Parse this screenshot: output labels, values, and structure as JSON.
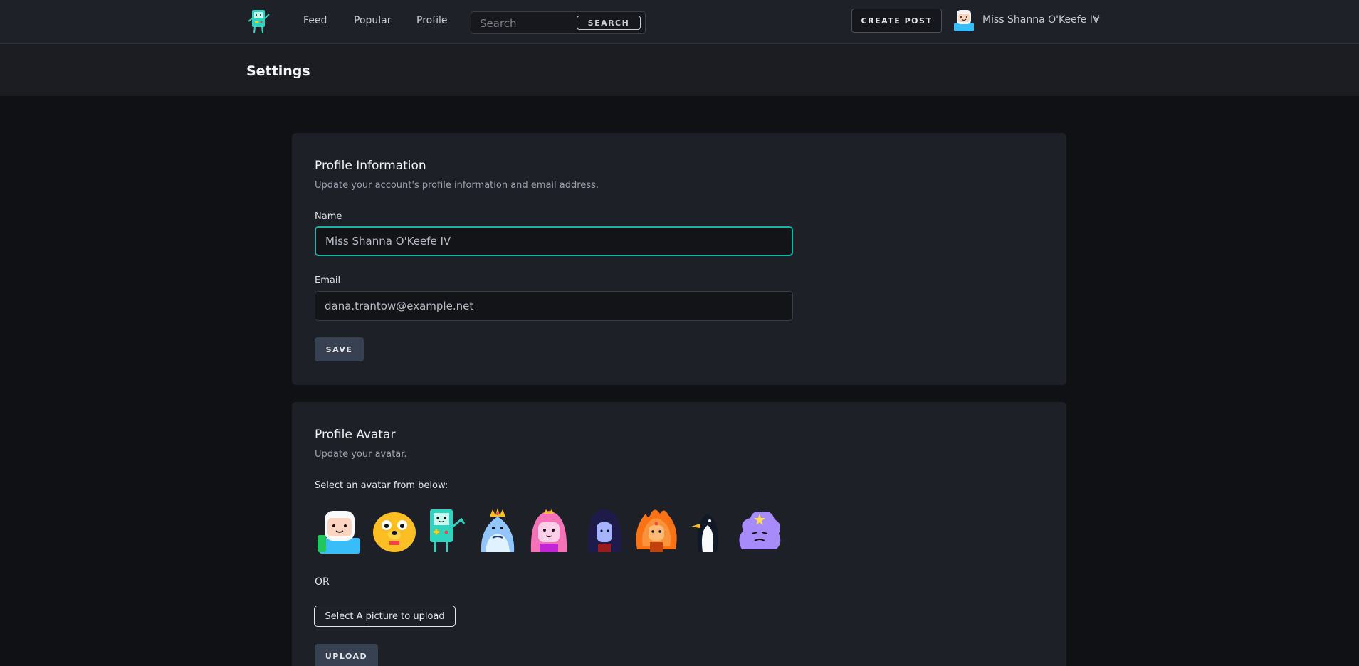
{
  "nav": {
    "links": [
      "Feed",
      "Popular",
      "Profile"
    ],
    "search_placeholder": "Search",
    "search_button": "SEARCH",
    "create_post": "CREATE POST",
    "user_name": "Miss Shanna O'Keefe IV"
  },
  "page": {
    "title": "Settings"
  },
  "profile_info": {
    "title": "Profile Information",
    "subtitle": "Update your account's profile information and email address.",
    "name_label": "Name",
    "name_value": "Miss Shanna O'Keefe IV",
    "email_label": "Email",
    "email_value": "dana.trantow@example.net",
    "save_button": "SAVE"
  },
  "profile_avatar": {
    "title": "Profile Avatar",
    "subtitle": "Update your avatar.",
    "select_label": "Select an avatar from below:",
    "avatars": [
      "finn-avatar",
      "jake-avatar",
      "bmo-avatar",
      "ice-king-avatar",
      "princess-bubblegum-avatar",
      "marceline-avatar",
      "flame-princess-avatar",
      "gunter-avatar",
      "lumpy-space-princess-avatar"
    ],
    "or_text": "OR",
    "upload_select": "Select A picture to upload",
    "upload_button": "UPLOAD"
  },
  "colors": {
    "accent": "#14b8a6",
    "background": "#0f1115",
    "card": "#1e2027"
  }
}
